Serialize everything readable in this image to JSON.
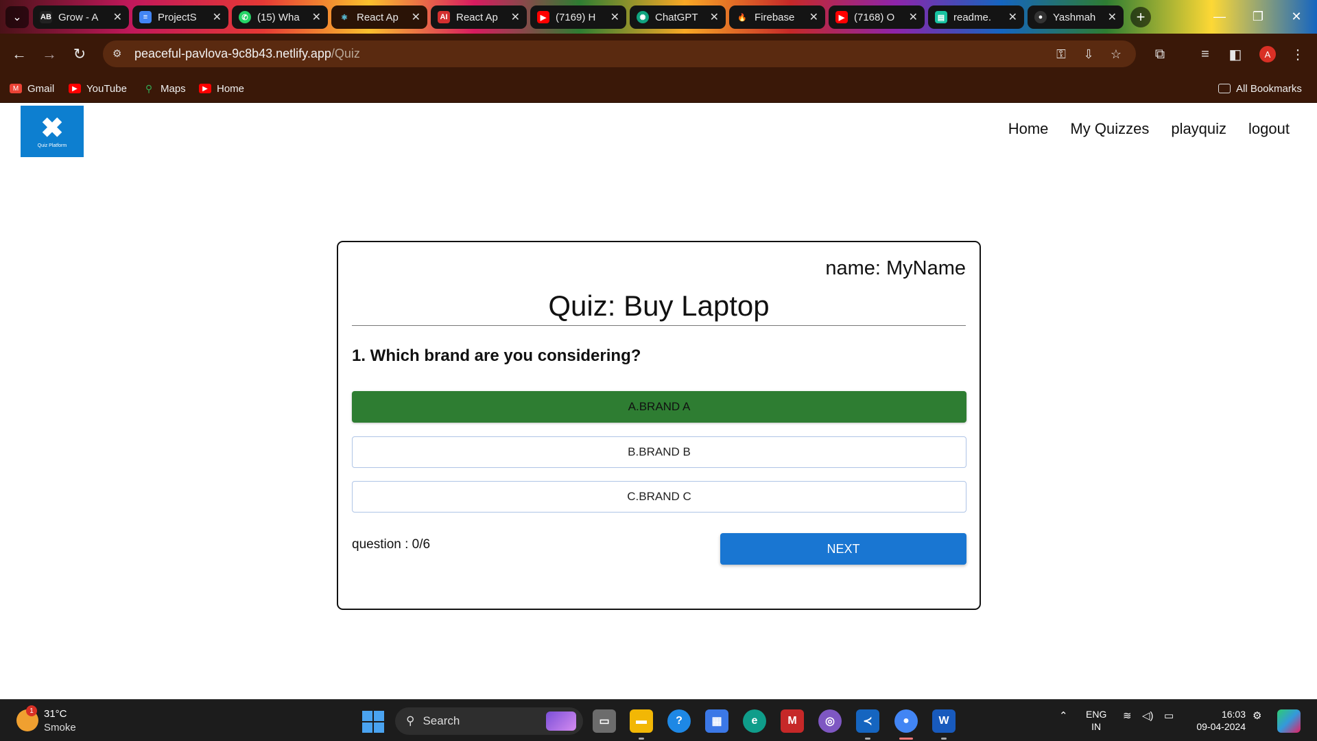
{
  "browser": {
    "tabs": [
      {
        "title": "Grow - A",
        "icon": "ab-icon",
        "color": "#222222"
      },
      {
        "title": "ProjectS",
        "icon": "docs-icon",
        "color": "#4285f4"
      },
      {
        "title": "(15) Wha",
        "icon": "whatsapp-icon",
        "color": "#25d366"
      },
      {
        "title": "React Ap",
        "icon": "react-icon",
        "color": "#61dafb"
      },
      {
        "title": "React Ap",
        "icon": "ai-icon",
        "color": "#d32f2f"
      },
      {
        "title": "(7169) H",
        "icon": "youtube-icon",
        "color": "#ff0000"
      },
      {
        "title": "ChatGPT",
        "icon": "chatgpt-icon",
        "color": "#10a37f"
      },
      {
        "title": "Firebase",
        "icon": "firebase-icon",
        "color": "#ffa000"
      },
      {
        "title": "(7168) O",
        "icon": "youtube-icon",
        "color": "#ff0000"
      },
      {
        "title": "readme.",
        "icon": "readme-icon",
        "color": "#18c2a0"
      },
      {
        "title": "Yashmah",
        "icon": "github-icon",
        "color": "#333333"
      }
    ],
    "url_host": "peaceful-pavlova-9c8b43.netlify.app",
    "url_path": "/Quiz",
    "profile_initial": "A",
    "bookmarks": [
      {
        "label": "Gmail",
        "icon": "gmail-icon"
      },
      {
        "label": "YouTube",
        "icon": "youtube-icon"
      },
      {
        "label": "Maps",
        "icon": "maps-icon"
      },
      {
        "label": "Home",
        "icon": "youtube-icon"
      }
    ],
    "all_bookmarks": "All Bookmarks"
  },
  "app": {
    "logo_text": "Quiz Platform",
    "nav": [
      "Home",
      "My Quizzes",
      "playquiz",
      "logout"
    ]
  },
  "quiz": {
    "name_label": "name: MyName",
    "title": "Quiz: Buy Laptop",
    "question": "1. Which brand are you considering?",
    "options": [
      {
        "label": "A.BRAND A",
        "selected": true
      },
      {
        "label": "B.BRAND B",
        "selected": false
      },
      {
        "label": "C.BRAND C",
        "selected": false
      }
    ],
    "progress": "question : 0/6",
    "next_label": "NEXT",
    "colors": {
      "selected": "#2e7d32",
      "primary": "#1976d2"
    }
  },
  "taskbar": {
    "weather_badge": "1",
    "temperature": "31°C",
    "condition": "Smoke",
    "search_placeholder": "Search",
    "lang_top": "ENG",
    "lang_bottom": "IN",
    "time": "16:03",
    "date": "09-04-2024"
  }
}
